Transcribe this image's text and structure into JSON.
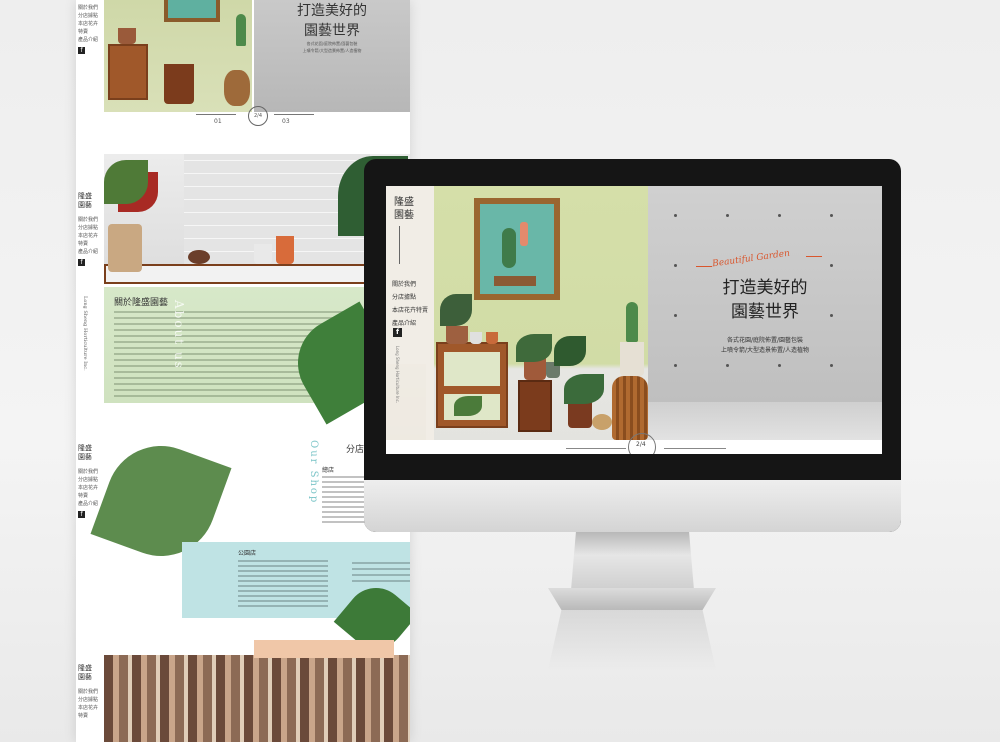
{
  "long_page": {
    "brand": "隆盛\n園藝",
    "nav": [
      "關於我們",
      "分店據點",
      "本店花卉特賣",
      "產品介紹"
    ],
    "facebook": "f",
    "vertical_tag": "Long Sheng Horticulture Inc.",
    "hero_title": "打造美好的\n園藝世界",
    "hero_sub": "各式花園/庭院佈置/園藝包裝\n上噴令箭/大型造景佈置/人造植物",
    "pager_left": "01",
    "pager_mid": "2/4",
    "pager_right": "03",
    "about_title": "關於隆盛園藝",
    "about_en": "About us",
    "shop_title": "分店據點",
    "shop_en": "Our Shop",
    "main_store": "總店",
    "branch_store": "公園店"
  },
  "screen": {
    "brand": "隆盛\n園藝",
    "nav": [
      "關於我們",
      "分店據點",
      "本店花卉特賣",
      "產品介紹"
    ],
    "facebook": "f",
    "vertical_tag": "Long Sheng Horticulture Inc.",
    "script_text": "Beautiful Garden",
    "title": "打造美好的\n園藝世界",
    "subtitle": "各式花園/庭院佈置/園藝包裝\n上噴令箭/大型造景佈置/人造植物",
    "pager": "2/4"
  },
  "colors": {
    "accent_script": "#d9562d",
    "wall_green": "#d5dfa9",
    "about_green": "#d7e8c9",
    "shop_blue": "#bfe3e4",
    "shop_en": "#7cc5c8"
  }
}
